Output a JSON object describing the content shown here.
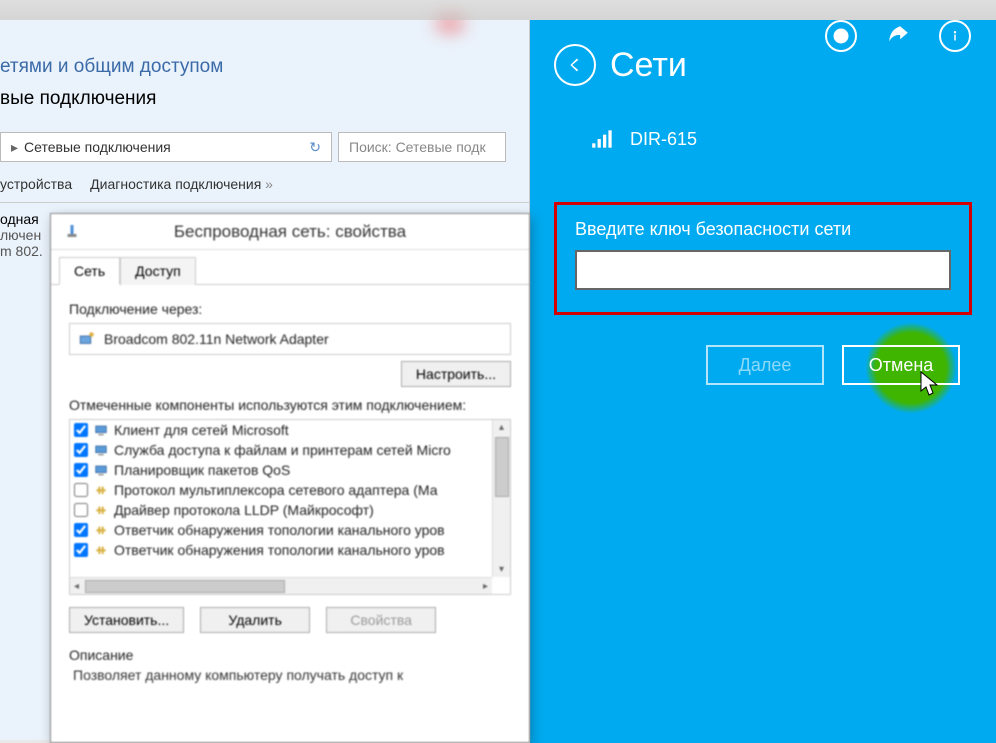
{
  "explorer": {
    "title_line1": "етями и общим доступом",
    "title_line2": "вые подключения",
    "breadcrumb": "Сетевые подключения",
    "search_placeholder": "Поиск: Сетевые подк",
    "toolbar_item1": "устройства",
    "toolbar_item2": "Диагностика подключения",
    "adapter_partial1": "одная",
    "adapter_partial2": "лючен",
    "adapter_partial3": "m 802."
  },
  "props": {
    "title": "Беспроводная сеть: свойства",
    "tab_network": "Сеть",
    "tab_access": "Доступ",
    "connect_via": "Подключение через:",
    "adapter_name": "Broadcom 802.11n Network Adapter",
    "btn_configure": "Настроить...",
    "components_label": "Отмеченные компоненты используются этим подключением:",
    "components": [
      {
        "checked": true,
        "kind": "client",
        "label": "Клиент для сетей Microsoft"
      },
      {
        "checked": true,
        "kind": "service",
        "label": "Служба доступа к файлам и принтерам сетей Micro"
      },
      {
        "checked": true,
        "kind": "service",
        "label": "Планировщик пакетов QoS"
      },
      {
        "checked": false,
        "kind": "proto",
        "label": "Протокол мультиплексора сетевого адаптера (Ма"
      },
      {
        "checked": false,
        "kind": "proto",
        "label": "Драйвер протокола LLDP (Майкрософт)"
      },
      {
        "checked": true,
        "kind": "proto",
        "label": "Ответчик обнаружения топологии канального уров"
      },
      {
        "checked": true,
        "kind": "proto",
        "label": "Ответчик обнаружения топологии канального уров"
      }
    ],
    "btn_install": "Установить...",
    "btn_remove": "Удалить",
    "btn_props": "Свойства",
    "desc_head": "Описание",
    "desc_text": "Позволяет данному компьютеру получать доступ к"
  },
  "charm": {
    "title": "Сети",
    "network_name": "DIR-615",
    "key_label": "Введите ключ безопасности сети",
    "key_value": "",
    "btn_next": "Далее",
    "btn_cancel": "Отмена"
  }
}
